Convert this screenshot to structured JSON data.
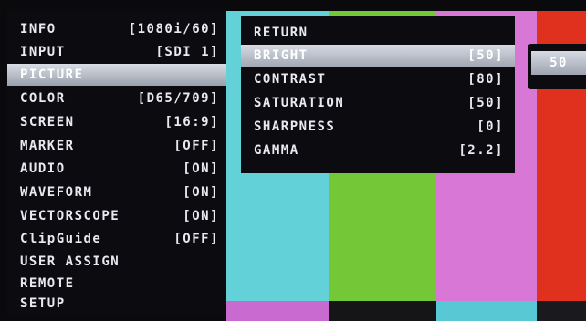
{
  "colors": {
    "bar_cyan": "#62d2d8",
    "bar_green": "#74c838",
    "bar_magenta": "#d977d6",
    "bar_red": "#e0301e",
    "panel_bg": "#0b0b10",
    "highlight": "#b8bcc6"
  },
  "main_menu": {
    "items": [
      {
        "label": "INFO",
        "value": "[1080i/60]"
      },
      {
        "label": "INPUT",
        "value": "[SDI 1]"
      },
      {
        "label": "PICTURE",
        "value": "",
        "selected": true
      },
      {
        "label": "COLOR",
        "value": "[D65/709]"
      },
      {
        "label": "SCREEN",
        "value": "[16:9]"
      },
      {
        "label": "MARKER",
        "value": "[OFF]"
      },
      {
        "label": "AUDIO",
        "value": "[ON]"
      },
      {
        "label": "WAVEFORM",
        "value": "[ON]"
      },
      {
        "label": "VECTORSCOPE",
        "value": "[ON]"
      },
      {
        "label": "ClipGuide",
        "value": "[OFF]"
      },
      {
        "label": "USER ASSIGN",
        "value": ""
      },
      {
        "label": "REMOTE",
        "value": ""
      },
      {
        "label": "SETUP",
        "value": ""
      }
    ]
  },
  "picture_menu": {
    "items": [
      {
        "label": "RETURN",
        "value": ""
      },
      {
        "label": "BRIGHT",
        "value": "[50]",
        "selected": true
      },
      {
        "label": "CONTRAST",
        "value": "[80]"
      },
      {
        "label": "SATURATION",
        "value": "[50]"
      },
      {
        "label": "SHARPNESS",
        "value": "[0]"
      },
      {
        "label": "GAMMA",
        "value": "[2.2]"
      }
    ]
  },
  "value_editor": {
    "value": "50"
  }
}
